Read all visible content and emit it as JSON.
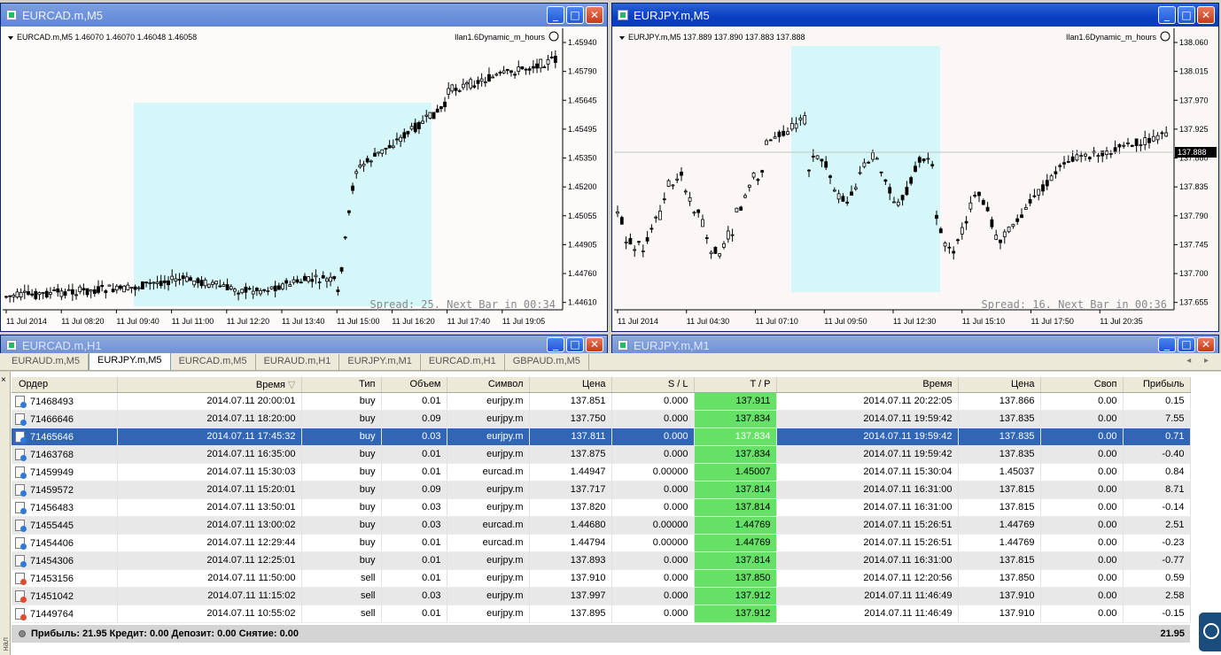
{
  "windows": {
    "left_chart": {
      "title": "EURCAD.m,M5",
      "header": "EURCAD.m,M5  1.46070 1.46070 1.46048 1.46058",
      "ea": "Ilan1.6Dynamic_m_hours",
      "spread_text": "Spread: 25. Next Bar in 00:34",
      "y_ticks": [
        "1.45940",
        "1.45790",
        "1.45645",
        "1.45495",
        "1.45350",
        "1.45200",
        "1.45055",
        "1.44905",
        "1.44760",
        "1.44610"
      ],
      "x_ticks": [
        "11 Jul 2014",
        "11 Jul 08:20",
        "11 Jul 09:40",
        "11 Jul 11:00",
        "11 Jul 12:20",
        "11 Jul 13:40",
        "11 Jul 15:00",
        "11 Jul 16:20",
        "11 Jul 17:40",
        "11 Jul 19:05"
      ]
    },
    "right_chart": {
      "title": "EURJPY.m,M5",
      "header": "EURJPY.m,M5  137.889 137.890 137.883 137.888",
      "ea": "Ilan1.6Dynamic_m_hours",
      "spread_text": "Spread: 16. Next Bar in 00:36",
      "price_marker": "137.888",
      "y_ticks": [
        "138.060",
        "138.015",
        "137.970",
        "137.925",
        "137.880",
        "137.835",
        "137.790",
        "137.745",
        "137.700",
        "137.655"
      ],
      "x_ticks": [
        "11 Jul 2014",
        "11 Jul 04:30",
        "11 Jul 07:10",
        "11 Jul 09:50",
        "11 Jul 12:30",
        "11 Jul 15:10",
        "11 Jul 17:50",
        "11 Jul 20:35"
      ]
    },
    "min_left": {
      "title": "EURCAD.m,H1"
    },
    "min_right": {
      "title": "EURJPY.m,M1"
    },
    "buttons": {
      "minimize": "_",
      "maximize": "□",
      "close": "✕"
    },
    "colors": {
      "active_title": "#0a3ec0",
      "highlight_zone": "#d6f7f9",
      "tp_cell": "#66e066",
      "selected_row": "#3166b4"
    }
  },
  "tabs": [
    "EURAUD.m,M5",
    "EURJPY.m,M5",
    "EURCAD.m,M5",
    "EURAUD.m,H1",
    "EURJPY.m,M1",
    "EURCAD.m,H1",
    "GBPAUD.m,M5"
  ],
  "tab_arrows": "◂ ▸",
  "terminal": {
    "close_label": "×",
    "columns": [
      "Ордер",
      "Время",
      "Тип",
      "Объем",
      "Символ",
      "Цена",
      "S / L",
      "T / P",
      "Время",
      "Цена",
      "Своп",
      "Прибыль"
    ],
    "rows": [
      [
        "71468493",
        "2014.07.11 20:00:01",
        "buy",
        "0.01",
        "eurjpy.m",
        "137.851",
        "0.000",
        "137.911",
        "2014.07.11 20:22:05",
        "137.866",
        "0.00",
        "0.15"
      ],
      [
        "71466646",
        "2014.07.11 18:20:00",
        "buy",
        "0.09",
        "eurjpy.m",
        "137.750",
        "0.000",
        "137.834",
        "2014.07.11 19:59:42",
        "137.835",
        "0.00",
        "7.55"
      ],
      [
        "71465646",
        "2014.07.11 17:45:32",
        "buy",
        "0.03",
        "eurjpy.m",
        "137.811",
        "0.000",
        "137.834",
        "2014.07.11 19:59:42",
        "137.835",
        "0.00",
        "0.71"
      ],
      [
        "71463768",
        "2014.07.11 16:35:00",
        "buy",
        "0.01",
        "eurjpy.m",
        "137.875",
        "0.000",
        "137.834",
        "2014.07.11 19:59:42",
        "137.835",
        "0.00",
        "-0.40"
      ],
      [
        "71459949",
        "2014.07.11 15:30:03",
        "buy",
        "0.01",
        "eurcad.m",
        "1.44947",
        "0.00000",
        "1.45007",
        "2014.07.11 15:30:04",
        "1.45037",
        "0.00",
        "0.84"
      ],
      [
        "71459572",
        "2014.07.11 15:20:01",
        "buy",
        "0.09",
        "eurjpy.m",
        "137.717",
        "0.000",
        "137.814",
        "2014.07.11 16:31:00",
        "137.815",
        "0.00",
        "8.71"
      ],
      [
        "71456483",
        "2014.07.11 13:50:01",
        "buy",
        "0.03",
        "eurjpy.m",
        "137.820",
        "0.000",
        "137.814",
        "2014.07.11 16:31:00",
        "137.815",
        "0.00",
        "-0.14"
      ],
      [
        "71455445",
        "2014.07.11 13:00:02",
        "buy",
        "0.03",
        "eurcad.m",
        "1.44680",
        "0.00000",
        "1.44769",
        "2014.07.11 15:26:51",
        "1.44769",
        "0.00",
        "2.51"
      ],
      [
        "71454406",
        "2014.07.11 12:29:44",
        "buy",
        "0.01",
        "eurcad.m",
        "1.44794",
        "0.00000",
        "1.44769",
        "2014.07.11 15:26:51",
        "1.44769",
        "0.00",
        "-0.23"
      ],
      [
        "71454306",
        "2014.07.11 12:25:01",
        "buy",
        "0.01",
        "eurjpy.m",
        "137.893",
        "0.000",
        "137.814",
        "2014.07.11 16:31:00",
        "137.815",
        "0.00",
        "-0.77"
      ],
      [
        "71453156",
        "2014.07.11 11:50:00",
        "sell",
        "0.01",
        "eurjpy.m",
        "137.910",
        "0.000",
        "137.850",
        "2014.07.11 12:20:56",
        "137.850",
        "0.00",
        "0.59"
      ],
      [
        "71451042",
        "2014.07.11 11:15:02",
        "sell",
        "0.03",
        "eurjpy.m",
        "137.997",
        "0.000",
        "137.912",
        "2014.07.11 11:46:49",
        "137.910",
        "0.00",
        "2.58"
      ],
      [
        "71449764",
        "2014.07.11 10:55:02",
        "sell",
        "0.01",
        "eurjpy.m",
        "137.895",
        "0.000",
        "137.912",
        "2014.07.11 11:46:49",
        "137.910",
        "0.00",
        "-0.15"
      ]
    ],
    "selected_row": 2,
    "summary": "Прибыль: 21.95  Кредит: 0.00  Депозит: 0.00  Снятие: 0.00",
    "total": "21.95",
    "side_label": "нал"
  }
}
